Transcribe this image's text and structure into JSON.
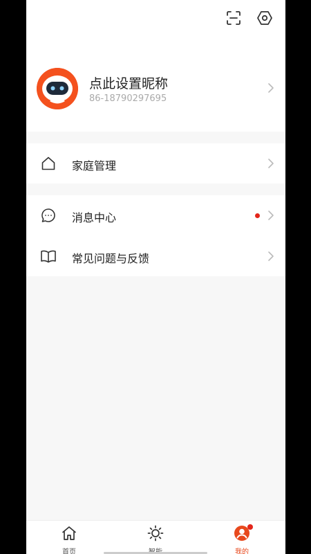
{
  "profile": {
    "nickname": "点此设置昵称",
    "phone": "86-18790297695"
  },
  "menu": {
    "family_label": "家庭管理",
    "messages_label": "消息中心",
    "faq_label": "常见问题与反馈"
  },
  "tabs": [
    {
      "label": "首页",
      "icon": "home-icon"
    },
    {
      "label": "智能",
      "icon": "sun-icon"
    },
    {
      "label": "我的",
      "icon": "user-icon",
      "active": true
    }
  ],
  "colors": {
    "accent": "#e8491d",
    "badge": "#e3261b"
  }
}
